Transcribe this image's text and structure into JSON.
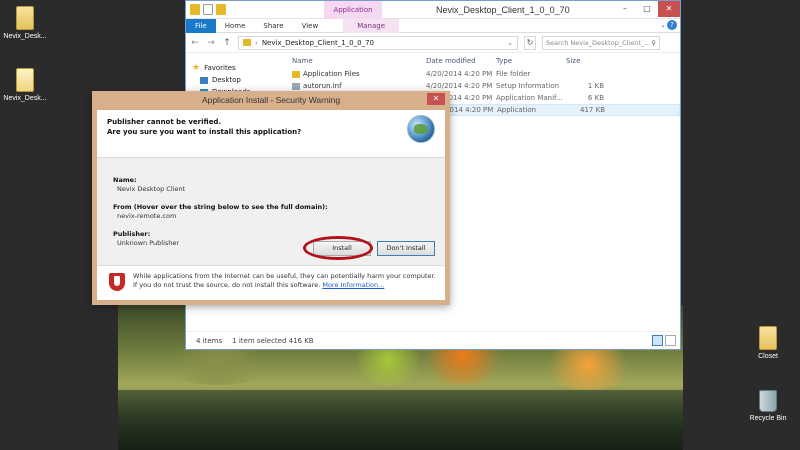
{
  "desktop": {
    "icons": [
      {
        "label": "Nevix_Desk..."
      },
      {
        "label": "Nevix_Desk..."
      },
      {
        "label": "Closet"
      },
      {
        "label": "Recycle Bin"
      }
    ]
  },
  "explorer": {
    "title": "Nevix_Desktop_Client_1_0_0_70",
    "context_tab": "Application Tools",
    "tabs": [
      "File",
      "Home",
      "Share",
      "View",
      "Manage"
    ],
    "address_path": "Nevix_Desktop_Client_1_0_0_70",
    "search_placeholder": "Search Nevix_Desktop_Client_...",
    "nav": [
      {
        "label": "Favorites",
        "icon": "star-icon"
      },
      {
        "label": "Desktop",
        "icon": "desktop-icon"
      },
      {
        "label": "Downloads",
        "icon": "downloads-icon"
      }
    ],
    "columns": [
      "Name",
      "Date modified",
      "Type",
      "Size"
    ],
    "files": [
      {
        "name": "Application Files",
        "date": "4/20/2014 4:20 PM",
        "type": "File folder",
        "size": "",
        "icon": "folder-icon",
        "selected": false
      },
      {
        "name": "autorun.inf",
        "date": "4/20/2014 4:20 PM",
        "type": "Setup Information",
        "size": "1 KB",
        "icon": "settings-file-icon",
        "selected": false
      },
      {
        "name": "",
        "date": "4/20/2014 4:20 PM",
        "type": "Application Manif...",
        "size": "6 KB",
        "icon": "manifest-icon",
        "selected": false
      },
      {
        "name": "",
        "date": "4/20/2014 4:20 PM",
        "type": "Application",
        "size": "417 KB",
        "icon": "app-icon",
        "selected": true
      }
    ],
    "status": {
      "items": "4 items",
      "selected": "1 item selected  416 KB"
    }
  },
  "dialog": {
    "title": "Application Install - Security Warning",
    "heading1": "Publisher cannot be verified.",
    "heading2": "Are you sure you want to install this application?",
    "name_label": "Name:",
    "name_value": "Nevix Desktop Client",
    "from_label": "From (Hover over the string below to see the full domain):",
    "from_value": "nevix-remote.com",
    "publisher_label": "Publisher:",
    "publisher_value": "Unknown Publisher",
    "install_label": "Install",
    "dont_install_label": "Don't Install",
    "footer_text": "While applications from the Internet can be useful, they can potentially harm your computer. If you do not trust the source, do not install this software.",
    "more_info": "More Information..."
  },
  "colors": {
    "dialog_border": "#d7b08b",
    "accent": "#1979ca",
    "annotation_ring": "#b3121a"
  }
}
